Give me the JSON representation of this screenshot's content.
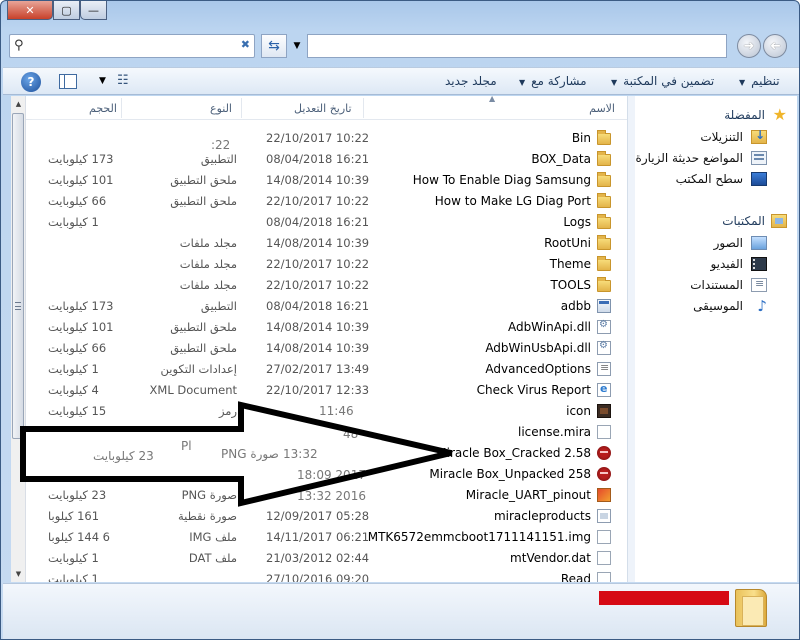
{
  "window": {
    "controls": {
      "close": "✕",
      "maximize": "▢",
      "minimize": "—"
    }
  },
  "toolbar": {
    "organize": "تنظيم",
    "include_in_library": "تضمين في المكتبة",
    "share_with": "مشاركة مع",
    "new_folder": "مجلد جديد",
    "help": "?"
  },
  "columns": {
    "name": "الاسم",
    "date_modified": "تاريخ التعديل",
    "type": "النوع",
    "size": "الحجم"
  },
  "files": [
    {
      "name": "Bin",
      "date": "22/10/2017 10:22",
      "type": "",
      "size": "",
      "icon": "folder-icon"
    },
    {
      "name": "BOX_Data",
      "date": "08/04/2018 16:21",
      "type": "التطبيق",
      "size": "173 كيلوبايت",
      "icon": "folder-icon"
    },
    {
      "name": "How To Enable Diag Samsung",
      "date": "14/08/2014 10:39",
      "type": "ملحق التطبيق",
      "size": "101 كيلوبايت",
      "icon": "folder-icon"
    },
    {
      "name": "How to Make LG Diag Port",
      "date": "22/10/2017 10:22",
      "type": "ملحق التطبيق",
      "size": "66 كيلوبايت",
      "icon": "folder-icon"
    },
    {
      "name": "Logs",
      "date": "08/04/2018 16:21",
      "type": "",
      "size": "1 كيلوبايت",
      "icon": "folder-icon"
    },
    {
      "name": "RootUni",
      "date": "14/08/2014 10:39",
      "type": "مجلد ملفات",
      "size": "",
      "icon": "folder-icon"
    },
    {
      "name": "Theme",
      "date": "22/10/2017 10:22",
      "type": "مجلد ملفات",
      "size": "",
      "icon": "folder-icon"
    },
    {
      "name": "TOOLS",
      "date": "22/10/2017 10:22",
      "type": "مجلد ملفات",
      "size": "",
      "icon": "folder-icon"
    },
    {
      "name": "adbb",
      "date": "08/04/2018 16:21",
      "type": "التطبيق",
      "size": "173 كيلوبايت",
      "icon": "application-icon"
    },
    {
      "name": "AdbWinApi.dll",
      "date": "14/08/2014 10:39",
      "type": "ملحق التطبيق",
      "size": "101 كيلوبايت",
      "icon": "dll-icon"
    },
    {
      "name": "AdbWinUsbApi.dll",
      "date": "14/08/2014 10:39",
      "type": "ملحق التطبيق",
      "size": "66 كيلوبايت",
      "icon": "dll-icon"
    },
    {
      "name": "AdvancedOptions",
      "date": "27/02/2017 13:49",
      "type": "إعدادات التكوين",
      "size": "1 كيلوبايت",
      "icon": "config-icon"
    },
    {
      "name": "Check Virus Report",
      "date": "22/10/2017 12:33",
      "type": "XML Document",
      "size": "4 كيلوبايت",
      "icon": "html-document-icon"
    },
    {
      "name": "icon",
      "date": "",
      "type": "رمز",
      "size": "15 كيلوبايت",
      "icon": "app-icon-file-icon"
    },
    {
      "name": "license.mira",
      "date": "",
      "type": "",
      "size": "",
      "icon": "blank-file-icon"
    },
    {
      "name": "Miracle Box_Cracked 2.58",
      "date": "",
      "type": "",
      "size": "",
      "icon": "miracle-app-icon"
    },
    {
      "name": "Miracle Box_Unpacked 258",
      "date": "",
      "type": "",
      "size": "",
      "icon": "miracle-app-icon"
    },
    {
      "name": "Miracle_UART_pinout",
      "date": "",
      "type": "صورة PNG",
      "size": "23 كيلوبايت",
      "icon": "png-image-icon"
    },
    {
      "name": "miracleproducts",
      "date": "12/09/2017 05:28",
      "type": "صورة نقطية",
      "size": "161 كيلوبا",
      "icon": "bitmap-image-icon"
    },
    {
      "name": "MTK6572emmcboot1711141151.img",
      "date": "14/11/2017 06:21",
      "type": "ملف IMG",
      "size": "6 144 كيلوبا",
      "icon": "img-file-icon"
    },
    {
      "name": "mtVendor.dat",
      "date": "21/03/2012 02:44",
      "type": "ملف DAT",
      "size": "1 كيلوبايت",
      "icon": "blank-file-icon"
    },
    {
      "name": "Read",
      "date": "27/10/2016 09:20",
      "type": "",
      "size": "1 كيلوبايت",
      "icon": "blank-file-icon"
    }
  ],
  "overlay_fragments": {
    "date_1": "22:",
    "date_2": "11:46",
    "date_3": "13:32",
    "type_png": "صورة PNG",
    "size_23": "23 كيلوبايت",
    "date_4": "2017 18:09",
    "date_5": "2016 13:32",
    "frag_48": "48",
    "frag_pl": "Pl"
  },
  "nav": {
    "favorites": "المفضلة",
    "downloads": "التنزيلات",
    "recent_places": "المواضع حديثة الزيارة",
    "desktop": "سطح المكتب",
    "libraries": "المكتبات",
    "pictures": "الصور",
    "videos": "الفيديو",
    "documents": "المستندات",
    "music": "الموسيقى"
  },
  "colors": {
    "accent": "#1e395b",
    "redaction": "#d60a14"
  }
}
